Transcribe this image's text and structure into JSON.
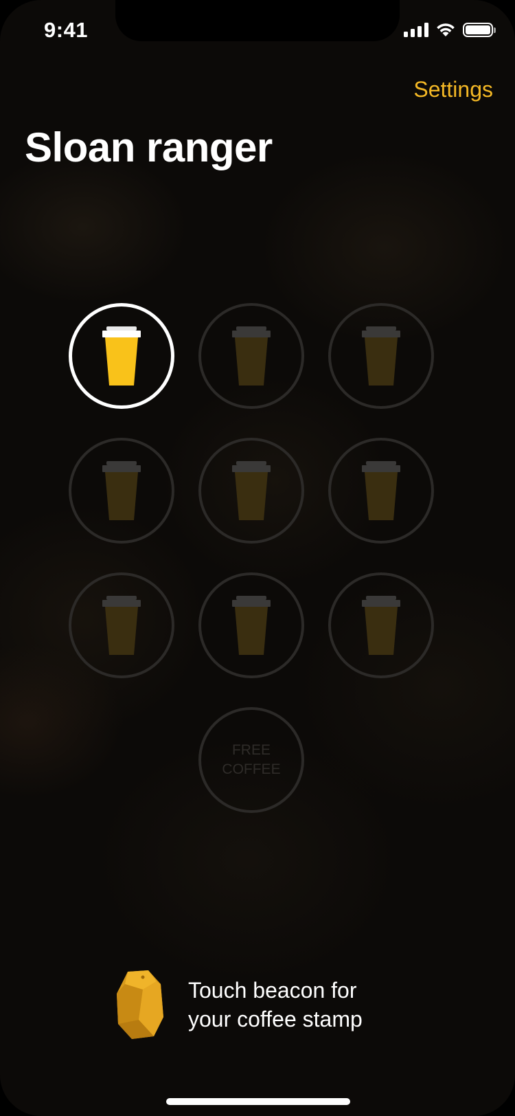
{
  "status_bar": {
    "time": "9:41"
  },
  "nav": {
    "settings_label": "Settings"
  },
  "title": "Sloan ranger",
  "colors": {
    "accent": "#f4b825",
    "cup_active": "#f9c21a",
    "cup_inactive": "#3a2e10",
    "lid_inactive": "#3a3938",
    "ring_inactive": "#2c2a28"
  },
  "stamp_card": {
    "total_stamps": 9,
    "collected": 1,
    "stamps": [
      {
        "state": "collected",
        "icon": "coffee-cup-icon"
      },
      {
        "state": "empty",
        "icon": "coffee-cup-icon"
      },
      {
        "state": "empty",
        "icon": "coffee-cup-icon"
      },
      {
        "state": "empty",
        "icon": "coffee-cup-icon"
      },
      {
        "state": "empty",
        "icon": "coffee-cup-icon"
      },
      {
        "state": "empty",
        "icon": "coffee-cup-icon"
      },
      {
        "state": "empty",
        "icon": "coffee-cup-icon"
      },
      {
        "state": "empty",
        "icon": "coffee-cup-icon"
      },
      {
        "state": "empty",
        "icon": "coffee-cup-icon"
      }
    ],
    "reward": {
      "line1": "FREE",
      "line2": "COFFEE"
    }
  },
  "beacon": {
    "icon": "beacon-icon",
    "line1": "Touch beacon for",
    "line2": "your coffee stamp"
  }
}
